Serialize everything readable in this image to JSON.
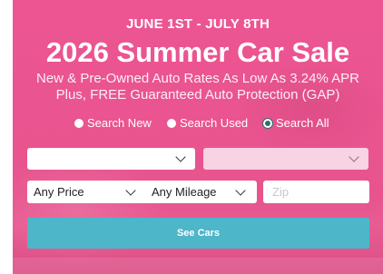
{
  "banner": {
    "date_range": "JUNE 1ST - JULY 8TH",
    "title": "2026 Summer Car Sale",
    "subtitle_line1": "New & Pre-Owned Auto Rates As Low As 3.24% APR",
    "subtitle_line2": "Plus, FREE Guaranteed Auto Protection (GAP)",
    "background_color": "#e9548f"
  },
  "search_type": {
    "options": [
      {
        "label": "Search New",
        "selected": false
      },
      {
        "label": "Search Used",
        "selected": false
      },
      {
        "label": "Search All",
        "selected": true
      }
    ]
  },
  "filters": {
    "make_value": "",
    "model_value": "",
    "price_value": "Any Price",
    "mileage_value": "Any Mileage",
    "zip_placeholder": "Zip",
    "zip_value": ""
  },
  "submit": {
    "label": "See Cars",
    "color": "#4db6c8"
  },
  "icons": {
    "dropdown": "chevron-down-icon",
    "radio": "radio-icon"
  }
}
